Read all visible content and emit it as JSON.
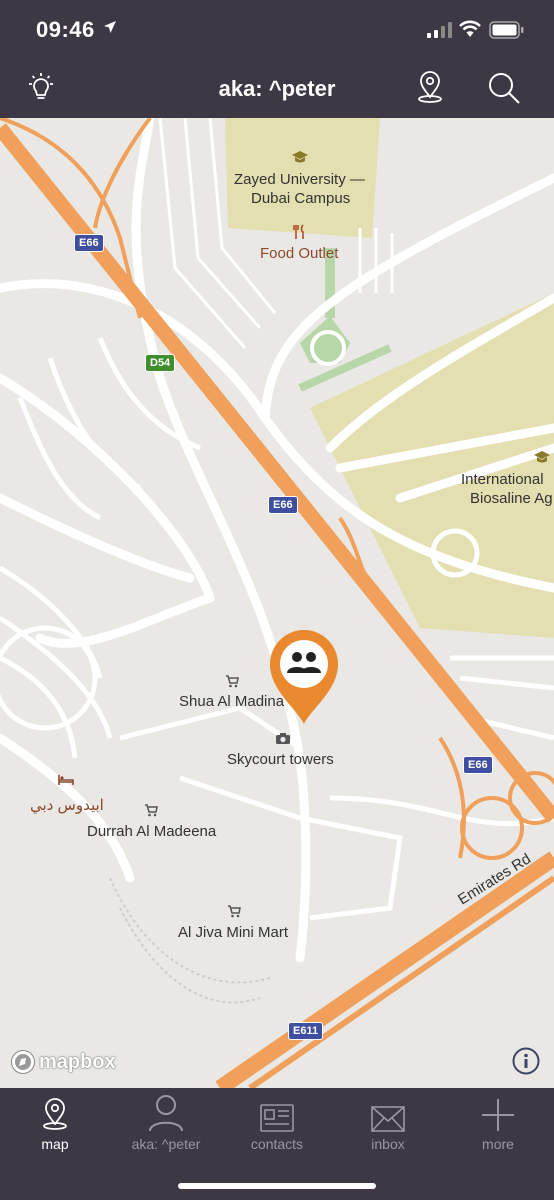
{
  "status_bar": {
    "time": "09:46"
  },
  "nav": {
    "title": "aka: ^peter",
    "left_icon": "lightbulb-icon",
    "right_icons": [
      "location-pin-icon",
      "search-icon"
    ]
  },
  "map": {
    "places": {
      "zayed_line1": "Zayed University —",
      "zayed_line2": "Dubai Campus",
      "food_outlet": "Food Outlet",
      "international_line1": "International",
      "international_line2": "Biosaline Ag",
      "shua": "Shua Al Madina",
      "skycourt": "Skycourt towers",
      "abidos": "ابيدوس دبي",
      "durrah": "Durrah Al Madeena",
      "aljiva": "Al Jiva Mini Mart"
    },
    "road_shields": {
      "e66_a": "E66",
      "d54": "D54",
      "e66_b": "E66",
      "e66_c": "E66",
      "e611": "E611"
    },
    "road_name": "Emirates Rd",
    "marker_icon": "group-icon",
    "attribution": "mapbox",
    "colors": {
      "highway": "#f0a05a",
      "land": "#e9e8e4",
      "campus": "#e3dfb0",
      "park": "#b7d7a8",
      "marker": "#e8892e"
    }
  },
  "tabs": [
    {
      "label": "map",
      "icon": "map-pin-icon",
      "active": true
    },
    {
      "label": "aka: ^peter",
      "icon": "person-icon",
      "active": false
    },
    {
      "label": "contacts",
      "icon": "contacts-card-icon",
      "active": false
    },
    {
      "label": "inbox",
      "icon": "envelope-icon",
      "active": false
    },
    {
      "label": "more",
      "icon": "plus-icon",
      "active": false
    }
  ]
}
